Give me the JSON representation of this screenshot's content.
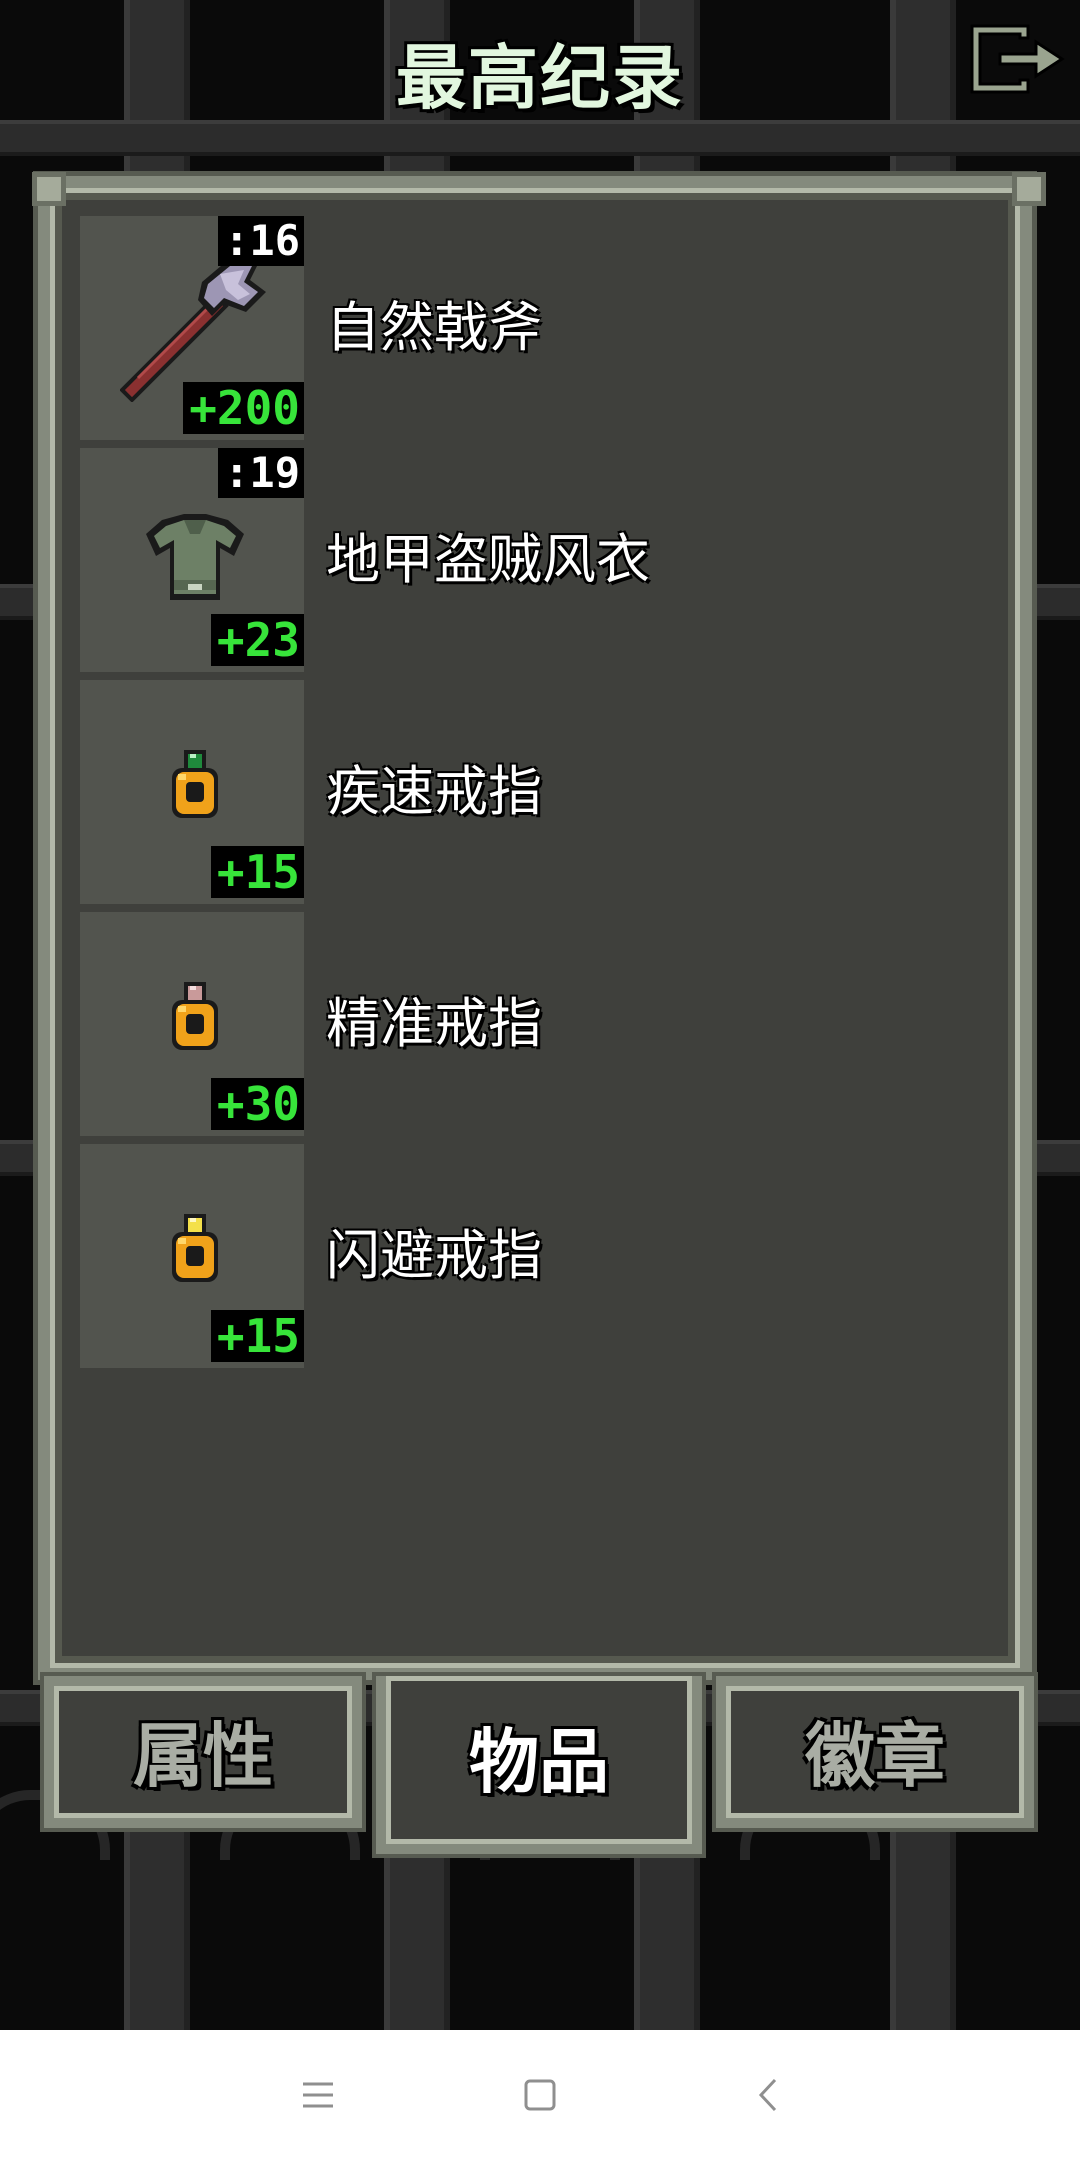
{
  "header": {
    "title": "最高纪录",
    "exit_icon": "exit-icon"
  },
  "items": [
    {
      "name": "自然戟斧",
      "quantity": ":16",
      "level": "+200",
      "icon": "halberd-icon"
    },
    {
      "name": "地甲盗贼风衣",
      "quantity": ":19",
      "level": "+23",
      "icon": "armor-icon"
    },
    {
      "name": "疾速戒指",
      "quantity": "",
      "level": "+15",
      "icon": "ring-emerald-icon"
    },
    {
      "name": "精准戒指",
      "quantity": "",
      "level": "+30",
      "icon": "ring-pink-icon"
    },
    {
      "name": "闪避戒指",
      "quantity": "",
      "level": "+15",
      "icon": "ring-yellow-icon"
    }
  ],
  "tabs": [
    {
      "label": "属性",
      "active": false
    },
    {
      "label": "物品",
      "active": true
    },
    {
      "label": "徽章",
      "active": false
    }
  ],
  "navbar": {
    "menu_icon": "menu-icon",
    "home_icon": "home-icon",
    "back_icon": "back-icon"
  },
  "colors": {
    "panel_bg": "#3f403c",
    "panel_border": "#848a7d",
    "level_text": "#37e43a",
    "title_text": "#e2f7df"
  }
}
